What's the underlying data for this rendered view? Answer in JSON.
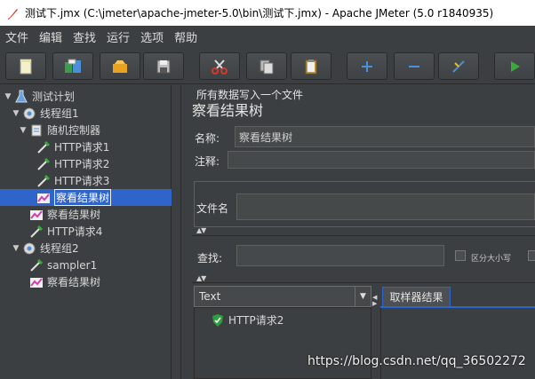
{
  "window": {
    "title": "测试下.jmx (C:\\jmeter\\apache-jmeter-5.0\\bin\\测试下.jmx) - Apache JMeter (5.0 r1840935)"
  },
  "menu": [
    "文件",
    "编辑",
    "查找",
    "运行",
    "选项",
    "帮助"
  ],
  "toolbar": [
    "new-icon",
    "templates-icon",
    "open-icon",
    "save-icon",
    "cut-icon",
    "copy-icon",
    "paste-icon",
    "expand-icon",
    "collapse-icon",
    "toggle-icon",
    "start-icon"
  ],
  "tree": {
    "test_plan": "测试计划",
    "thread_group_1": "线程组1",
    "random_controller": "随机控制器",
    "http_req_1": "HTTP请求1",
    "http_req_2": "HTTP请求2",
    "http_req_3": "HTTP请求3",
    "view_tree_selected": "察看结果树",
    "view_tree_2": "察看结果树",
    "http_req_4": "HTTP请求4",
    "thread_group_2": "线程组2",
    "sampler1": "sampler1",
    "view_tree_3": "察看结果树"
  },
  "panel": {
    "title": "察看结果树",
    "name_label": "名称:",
    "name_value": "察看结果树",
    "comment_label": "注释:",
    "comment_value": "",
    "group_label": "所有数据写入一个文件",
    "file_label": "文件名",
    "file_value": "",
    "search_label": "查找:",
    "search_value": "",
    "case_label": "区分大小写",
    "renderer": "Text",
    "result_item": "HTTP请求2",
    "tab_label": "取样器结果"
  },
  "watermark": "https://blog.csdn.net/qq_36502272",
  "colors": {
    "selection": "#2f65ca",
    "background": "#3c3f41",
    "success": "#2e9e3e"
  }
}
